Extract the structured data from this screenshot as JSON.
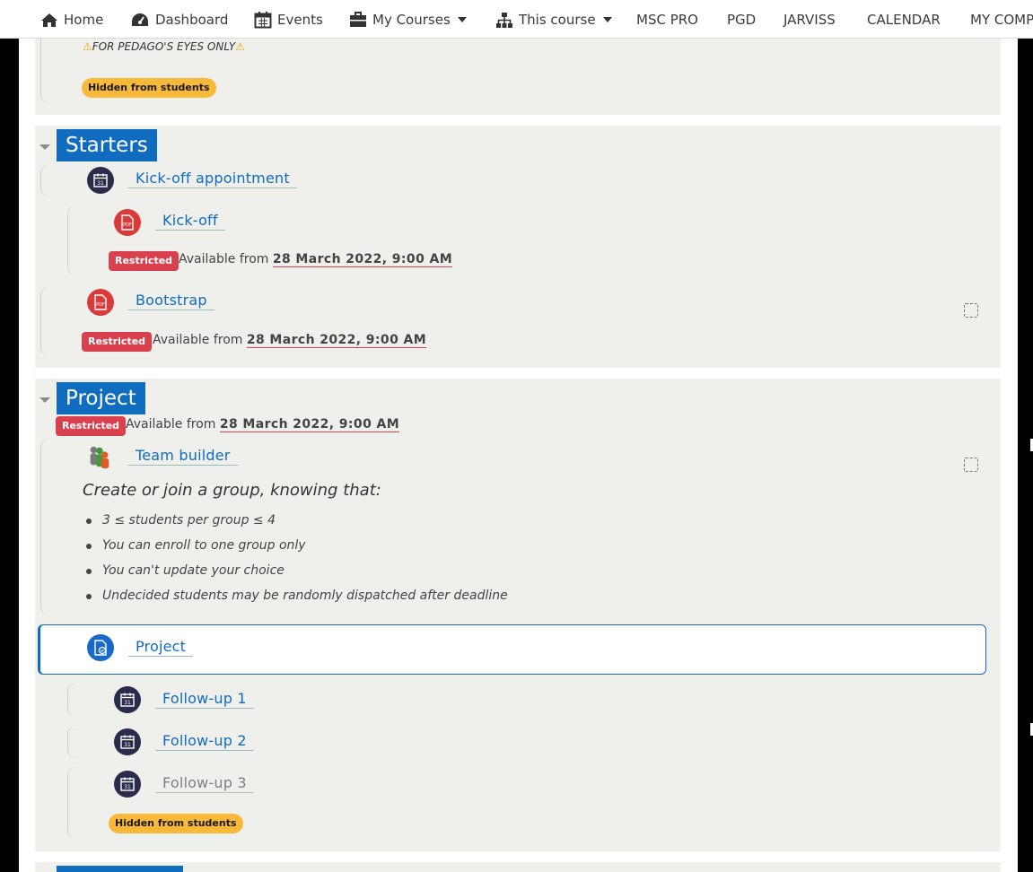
{
  "nav": {
    "home": "Home",
    "dashboard": "Dashboard",
    "events": "Events",
    "my_courses": "My Courses",
    "this_course": "This course",
    "msc_pro": "MSC PRO",
    "pgd": "PGD",
    "jarviss": "JARVISS",
    "calendar": "CALENDAR",
    "my_comp": "MY COMP"
  },
  "top_section": {
    "warning": "FOR PEDAGO'S EYES ONLY",
    "hidden_badge": "Hidden from students"
  },
  "starters": {
    "title": "Starters",
    "activities": [
      {
        "name": "Kick-off appointment",
        "icon": "calendar-icon"
      },
      {
        "name": "Kick-off",
        "icon": "pdf-icon",
        "restricted": "Restricted",
        "available": "Available from",
        "date": "28 March 2022, 9:00 AM"
      },
      {
        "name": "Bootstrap",
        "icon": "pdf-icon",
        "restricted": "Restricted",
        "available": "Available from",
        "date": "28 March 2022, 9:00 AM"
      }
    ]
  },
  "project": {
    "title": "Project",
    "restricted": "Restricted",
    "available": "Available from",
    "date": "28 March 2022, 9:00 AM",
    "team_builder": {
      "name": "Team builder",
      "desc_title": "Create or join a group, knowing that:",
      "rules": [
        "3 ≤ students per group ≤ 4",
        "You can enroll to one group only",
        "You can't update your choice",
        "Undecided students may be randomly dispatched after deadline"
      ]
    },
    "assignment": {
      "name": "Project"
    },
    "followups": [
      {
        "name": "Follow-up 1"
      },
      {
        "name": "Follow-up 2"
      },
      {
        "name": "Follow-up 3",
        "hidden_badge": "Hidden from students"
      }
    ]
  },
  "colors": {
    "accent": "#0f6cbf",
    "restricted": "#d9414f",
    "hidden": "#f8b838",
    "section_bg": "#efefec"
  }
}
